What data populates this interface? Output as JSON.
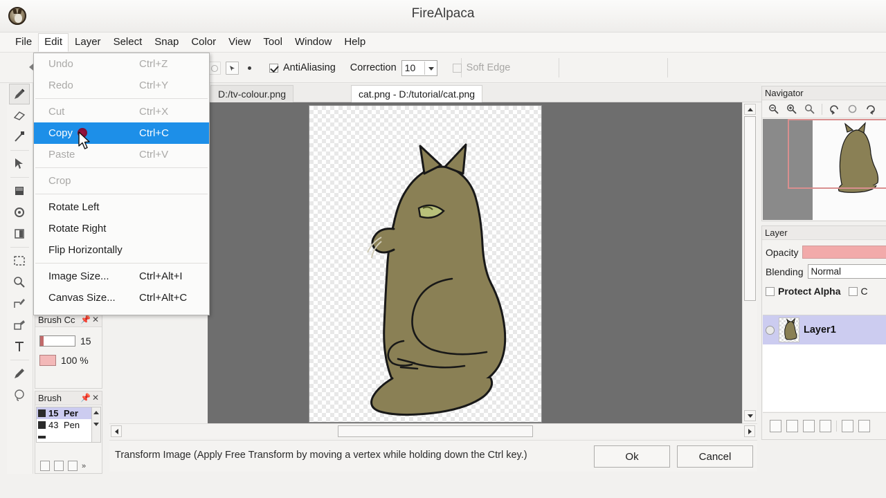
{
  "window": {
    "title": "FireAlpaca",
    "logo_icon": "alpaca-logo-icon"
  },
  "menubar": {
    "items": [
      {
        "label": "File",
        "open": false
      },
      {
        "label": "Edit",
        "open": true
      },
      {
        "label": "Layer",
        "open": false
      },
      {
        "label": "Select",
        "open": false
      },
      {
        "label": "Snap",
        "open": false
      },
      {
        "label": "Color",
        "open": false
      },
      {
        "label": "View",
        "open": false
      },
      {
        "label": "Tool",
        "open": false
      },
      {
        "label": "Window",
        "open": false
      },
      {
        "label": "Help",
        "open": false
      }
    ]
  },
  "edit_menu": {
    "items": [
      {
        "label": "Undo",
        "shortcut": "Ctrl+Z",
        "state": "disabled"
      },
      {
        "label": "Redo",
        "shortcut": "Ctrl+Y",
        "state": "disabled"
      },
      {
        "separator": true
      },
      {
        "label": "Cut",
        "shortcut": "Ctrl+X",
        "state": "disabled"
      },
      {
        "label": "Copy",
        "shortcut": "Ctrl+C",
        "state": "highlighted"
      },
      {
        "label": "Paste",
        "shortcut": "Ctrl+V",
        "state": "disabled"
      },
      {
        "separator": true
      },
      {
        "label": "Crop",
        "shortcut": "",
        "state": "disabled"
      },
      {
        "separator": true
      },
      {
        "label": "Rotate Left",
        "shortcut": "",
        "state": "enabled"
      },
      {
        "label": "Rotate Right",
        "shortcut": "",
        "state": "enabled"
      },
      {
        "label": "Flip Horizontally",
        "shortcut": "",
        "state": "enabled"
      },
      {
        "separator": true
      },
      {
        "label": "Image Size...",
        "shortcut": "Ctrl+Alt+I",
        "state": "enabled"
      },
      {
        "label": "Canvas Size...",
        "shortcut": "Ctrl+Alt+C",
        "state": "enabled"
      }
    ]
  },
  "options_bar": {
    "back_arrow_icon": "left-arrow-icon",
    "circle_button_icon": "circle-tool-icon",
    "pointer_button_icon": "pointer-tool-icon",
    "dot_icon": "dot-icon",
    "antialiasing": {
      "label": "AntiAliasing",
      "checked": true
    },
    "correction": {
      "label": "Correction",
      "value": "10"
    },
    "soft_edge": {
      "label": "Soft Edge",
      "checked": false,
      "enabled": false
    }
  },
  "toolbar": {
    "tools": [
      {
        "name": "pen-tool",
        "icon": "pen-icon",
        "active": true
      },
      {
        "name": "eraser-tool",
        "icon": "eraser-icon",
        "active": false
      },
      {
        "name": "blur-tool",
        "icon": "blur-icon",
        "active": false
      },
      {
        "name": "move-tool",
        "icon": "move-arrow-icon",
        "active": false
      },
      {
        "name": "bucket-tool",
        "icon": "bucket-icon",
        "active": false
      },
      {
        "name": "gradient-tool",
        "icon": "gradient-icon",
        "active": false
      },
      {
        "name": "pattern-tool",
        "icon": "pattern-icon",
        "active": false
      },
      {
        "name": "select-tool",
        "icon": "marquee-icon",
        "active": false
      },
      {
        "name": "zoom-tool",
        "icon": "magnifier-icon",
        "active": false
      },
      {
        "name": "polyline-tool",
        "icon": "polyline-icon",
        "active": false
      },
      {
        "name": "shape-tool",
        "icon": "shape-icon",
        "active": false
      },
      {
        "name": "text-tool",
        "icon": "text-t-icon",
        "active": false
      },
      {
        "name": "eyedropper-tool",
        "icon": "eyedropper-icon",
        "active": false
      },
      {
        "name": "lasso-tool",
        "icon": "lasso-icon",
        "active": false
      }
    ]
  },
  "brush_control": {
    "title": "Brush Cc",
    "pin_icon": "pin-icon",
    "close_icon": "close-icon",
    "size_value": "15",
    "opacity_value": "100 %"
  },
  "brush_panel": {
    "title": "Brush",
    "pin_icon": "pin-icon",
    "close_icon": "close-icon",
    "brushes": [
      {
        "size": "15",
        "name": "Per",
        "selected": true
      },
      {
        "size": "43",
        "name": "Pen",
        "selected": false
      }
    ],
    "scroll_up_icon": "scroll-up-icon",
    "scroll_down_icon": "scroll-down-icon",
    "buttons": [
      "new-brush-icon",
      "edit-brush-icon",
      "duplicate-brush-icon",
      "more-icon"
    ]
  },
  "document_tabs": [
    {
      "label": "D:/tv-colour.png",
      "active": false
    },
    {
      "label": "cat.png - D:/tutorial/cat.png",
      "active": true
    }
  ],
  "canvas": {
    "artwork": "sitting-cat-illustration",
    "cat_body_color": "#8a8055",
    "cat_outline_color": "#1a1a1a",
    "cat_eye_color": "#b8c07a",
    "background": "transparent-checkerboard"
  },
  "navigator": {
    "title": "Navigator",
    "tools": [
      {
        "name": "zoom-out-icon"
      },
      {
        "name": "zoom-in-icon"
      },
      {
        "name": "zoom-reset-icon"
      },
      {
        "name": "rotate-left-icon"
      },
      {
        "name": "rotate-reset-icon"
      },
      {
        "name": "rotate-right-icon"
      }
    ],
    "viewbox_color": "#d98f8f"
  },
  "layer_panel": {
    "title": "Layer",
    "opacity_label": "Opacity",
    "opacity_color": "#f2aaaa",
    "blending_label": "Blending",
    "blending_value": "Normal",
    "protect_alpha": {
      "label": "Protect Alpha",
      "checked": false
    },
    "clipping": {
      "label": "C",
      "checked": false
    },
    "layers": [
      {
        "name": "Layer1",
        "visible": true,
        "selected": true
      }
    ],
    "buttons": [
      "add-layer-icon",
      "duplicate-layer-icon",
      "copy-layer-icon",
      "folder-icon",
      "merge-layer-icon",
      "delete-layer-icon"
    ]
  },
  "status_bar": {
    "message": "Transform Image (Apply Free Transform by moving a vertex while holding down the Ctrl key.)",
    "ok_label": "Ok",
    "cancel_label": "Cancel"
  },
  "cursor": {
    "icon": "arrow-cursor-icon",
    "click_marker_color": "#8c1139"
  }
}
